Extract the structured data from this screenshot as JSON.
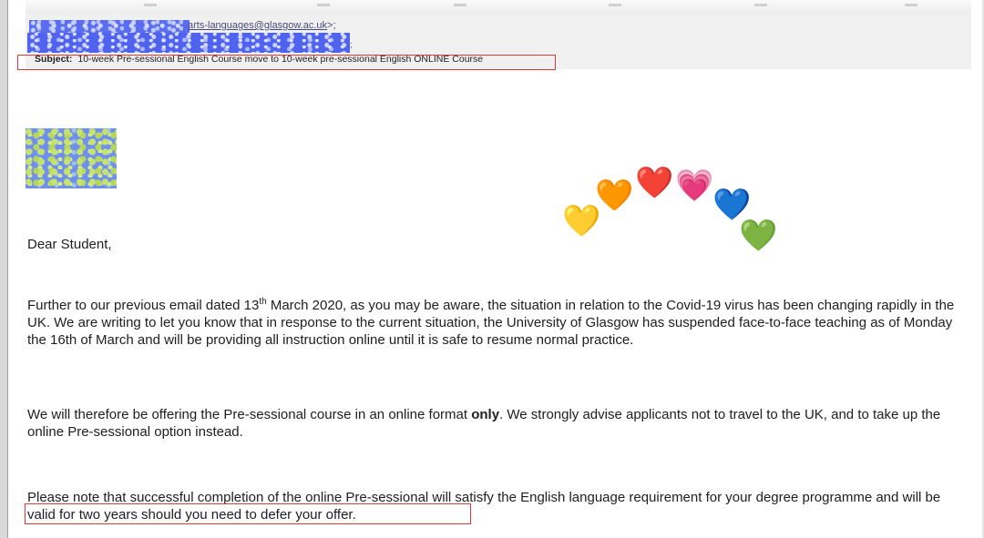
{
  "header": {
    "email_address": "arts-languages@glasgow.ac.uk",
    "email_suffix": ">;",
    "second_line_suffix": ";",
    "subject_label": "Subject:",
    "subject_text": "10-week Pre-sessional English Course move to 10-week pre-sessional English ONLINE Course"
  },
  "decoration": {
    "hearts": [
      "💛",
      "🧡",
      "❤️",
      "💗",
      "💙",
      "💚"
    ],
    "heart_colors": [
      "#f7c93a",
      "#f58a3c",
      "#e52b2b",
      "#e84fb6",
      "#2b78e4",
      "#3fbb3a"
    ]
  },
  "body": {
    "greeting": "Dear Student,",
    "para1_part1": "Further to our previous email dated 13",
    "para1_sup": "th",
    "para1_part2": " March 2020, as you may be aware, the situation in relation to the Covid-19 virus has been changing rapidly in the UK. We are writing to let you know that in response to the current situation, the University of Glasgow has suspended face-to-face teaching as of Monday the 16th of March and will be providing all instruction online until it is safe to resume normal practice.",
    "para2_part1": "We will therefore be offering the Pre-sessional course in an online format ",
    "para2_bold": "only",
    "para2_part2": ". We strongly advise applicants not to travel to the UK, and to take up the online Pre-sessional option instead.",
    "para3": "Please note that successful completion of the online Pre-sessional will satisfy the English language requirement for your degree programme and will be valid for two years should you need to defer your offer."
  }
}
